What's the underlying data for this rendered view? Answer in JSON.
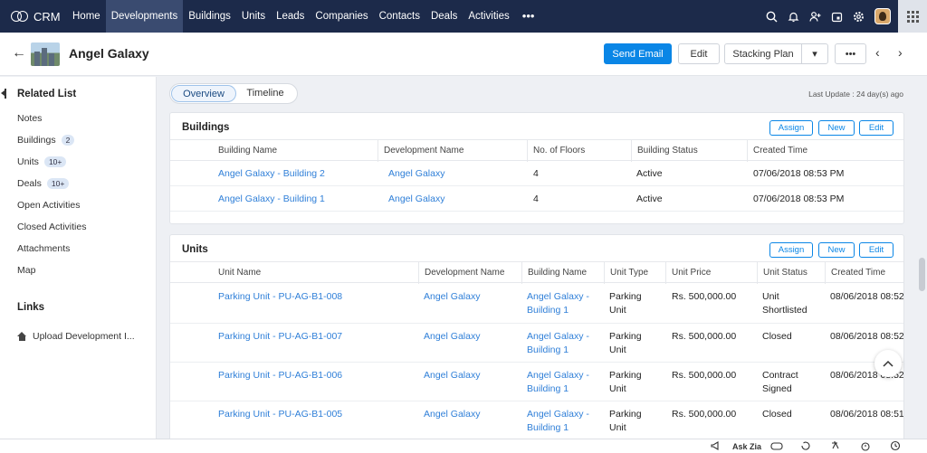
{
  "nav": {
    "brand": "CRM",
    "items": [
      {
        "label": "Home",
        "active": false
      },
      {
        "label": "Developments",
        "active": true
      },
      {
        "label": "Buildings",
        "active": false
      },
      {
        "label": "Units",
        "active": false
      },
      {
        "label": "Leads",
        "active": false
      },
      {
        "label": "Companies",
        "active": false
      },
      {
        "label": "Contacts",
        "active": false
      },
      {
        "label": "Deals",
        "active": false
      },
      {
        "label": "Activities",
        "active": false
      }
    ],
    "more": "•••",
    "right_icons": [
      "search-icon",
      "bell-icon",
      "user-plus-icon",
      "calendar-icon",
      "settings-icon"
    ],
    "colors": {
      "bar": "#1c2a4a",
      "active": "#3a4b70"
    }
  },
  "header": {
    "title": "Angel Galaxy",
    "send_email": "Send Email",
    "edit": "Edit",
    "stacking_plan": "Stacking Plan",
    "dropdown": "▾",
    "more": "•••",
    "prev": "‹",
    "next": "›",
    "accent": "#0a86e6"
  },
  "sidebar": {
    "title": "Related List",
    "items": [
      {
        "label": "Notes",
        "badge": ""
      },
      {
        "label": "Buildings",
        "badge": "2"
      },
      {
        "label": "Units",
        "badge": "10+"
      },
      {
        "label": "Deals",
        "badge": "10+"
      },
      {
        "label": "Open Activities",
        "badge": ""
      },
      {
        "label": "Closed Activities",
        "badge": ""
      },
      {
        "label": "Attachments",
        "badge": ""
      },
      {
        "label": "Map",
        "badge": ""
      }
    ],
    "links_title": "Links",
    "link_item": "Upload Development I..."
  },
  "tabs": {
    "overview": "Overview",
    "timeline": "Timeline",
    "active": "Overview"
  },
  "last_update": "Last Update : 24 day(s) ago",
  "buildings": {
    "title": "Buildings",
    "assign": "Assign",
    "new": "New",
    "edit": "Edit",
    "columns": [
      "Building Name",
      "Development Name",
      "No. of Floors",
      "Building Status",
      "Created Time"
    ],
    "rows": [
      [
        "Angel Galaxy - Building 2",
        "Angel Galaxy",
        "4",
        "Active",
        "07/06/2018 08:53 PM"
      ],
      [
        "Angel Galaxy - Building 1",
        "Angel Galaxy",
        "4",
        "Active",
        "07/06/2018 08:53 PM"
      ]
    ]
  },
  "units": {
    "title": "Units",
    "assign": "Assign",
    "new": "New",
    "edit": "Edit",
    "columns": [
      "Unit Name",
      "Development Name",
      "Building Name",
      "Unit Type",
      "Unit Price",
      "Unit Status",
      "Created Time"
    ],
    "rows": [
      {
        "name": "Parking Unit - PU-AG-B1-008",
        "dev": "Angel Galaxy",
        "bld1": "Angel Galaxy -",
        "bld2": "Building 1",
        "type1": "Parking",
        "type2": "Unit",
        "price": "Rs. 500,000.00",
        "status1": "Unit",
        "status2": "Shortlisted",
        "created": "08/06/2018 08:52"
      },
      {
        "name": "Parking Unit - PU-AG-B1-007",
        "dev": "Angel Galaxy",
        "bld1": "Angel Galaxy -",
        "bld2": "Building 1",
        "type1": "Parking",
        "type2": "Unit",
        "price": "Rs. 500,000.00",
        "status1": "Closed",
        "status2": "",
        "created": "08/06/2018 08:52"
      },
      {
        "name": "Parking Unit - PU-AG-B1-006",
        "dev": "Angel Galaxy",
        "bld1": "Angel Galaxy -",
        "bld2": "Building 1",
        "type1": "Parking",
        "type2": "Unit",
        "price": "Rs. 500,000.00",
        "status1": "Contract",
        "status2": "Signed",
        "created": "08/06/2018 08:52"
      },
      {
        "name": "Parking Unit - PU-AG-B1-005",
        "dev": "Angel Galaxy",
        "bld1": "Angel Galaxy -",
        "bld2": "Building 1",
        "type1": "Parking",
        "type2": "Unit",
        "price": "Rs. 500,000.00",
        "status1": "Closed",
        "status2": "",
        "created": "08/06/2018 08:51"
      }
    ]
  },
  "bottom": {
    "ask_zia": "Ask Zia"
  }
}
